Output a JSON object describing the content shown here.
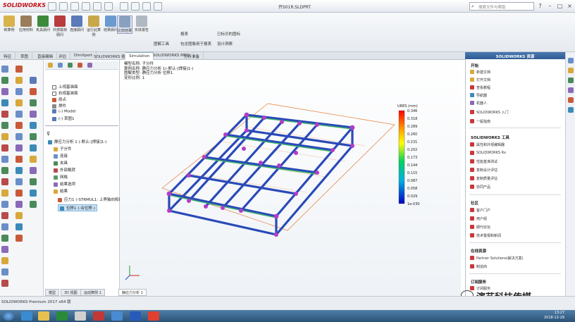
{
  "app": {
    "logo": "SOLIDWORKS",
    "window_title": "开S01R.SLDPRT",
    "search_placeholder": "搜索文件与帮助"
  },
  "ribbon": {
    "buttons": [
      "新算例",
      "应用材料",
      "夹具顾问",
      "外部载荷顾问",
      "连接顾问",
      "运行此算例",
      "结果顾问",
      "比较结果",
      "实体报告"
    ],
    "small_items": [
      "图解工具",
      "报表",
      "包含图像用于报表",
      "已标识的图标",
      "设计洞察"
    ]
  },
  "tabs": [
    "特征",
    "草图",
    "直接编辑",
    "评估",
    "DimXpert",
    "SOLIDWORKS 插件",
    "Simulation",
    "SOLIDWORKS MBD",
    "分析准备"
  ],
  "feature_tree": {
    "upper": [
      "上视基准面",
      "右视基准面",
      "原点",
      "焊件",
      "(-) Model",
      "(-) 草图1"
    ],
    "study_title": "静应力分析 1 (-默认-[焊接]1-)",
    "study_items": [
      "子分件",
      "连接",
      "夹具",
      "外部载荷",
      "网格",
      "结果选项"
    ],
    "results_label": "结果",
    "results": [
      "应力1 (-STRMUL1: 上界轴向和折弯",
      "位移1 (-合位移-)"
    ]
  },
  "viewport": {
    "info_lines": [
      "模型名称: 子分件",
      "算例名称: 静应力分析 1(-默认-[焊接]1-)",
      "图解类型: 静应力分析 位移1",
      "变形比例: 1"
    ],
    "legend_title": "URES (mm)",
    "legend_values": [
      "0.346",
      "0.318",
      "0.289",
      "0.260",
      "0.231",
      "0.202",
      "0.173",
      "0.144",
      "0.115",
      "0.087",
      "0.058",
      "0.029",
      "1e-030"
    ],
    "tabs": [
      "模型",
      "3D 视图",
      "运动算例 1",
      "静应力分析 1"
    ]
  },
  "task_pane": {
    "header": "SOLIDWORKS 资源",
    "sections": [
      {
        "title": "开始",
        "items": [
          "新建文档",
          "打开文档",
          "查看教程",
          "导航器",
          "机器人",
          "SOLIDWORKS 入门",
          "一般指南"
        ]
      },
      {
        "title": "SOLIDWORKS 工具",
        "items": [
          "属性和外观编辑器",
          "SOLIDWORKS Rx",
          "性能基准测试",
          "复制设计评估",
          "复制质量评估",
          "协同产品"
        ]
      },
      {
        "title": "社区",
        "items": [
          "客户门户",
          "用户组",
          "期刊论坛",
          "技术警报和新闻"
        ]
      },
      {
        "title": "在线资源",
        "items": [
          "Partner Solutions(解决方案)",
          "制造商"
        ]
      },
      {
        "title": "订阅服务",
        "items": [
          "订阅服务"
        ]
      }
    ]
  },
  "status": {
    "text": "SOLIDWORKS Premium 2017 x64 版"
  },
  "taskbar": {
    "time": "13:27",
    "date": "2018-12-29"
  },
  "watermark": "演艺科技传媒"
}
